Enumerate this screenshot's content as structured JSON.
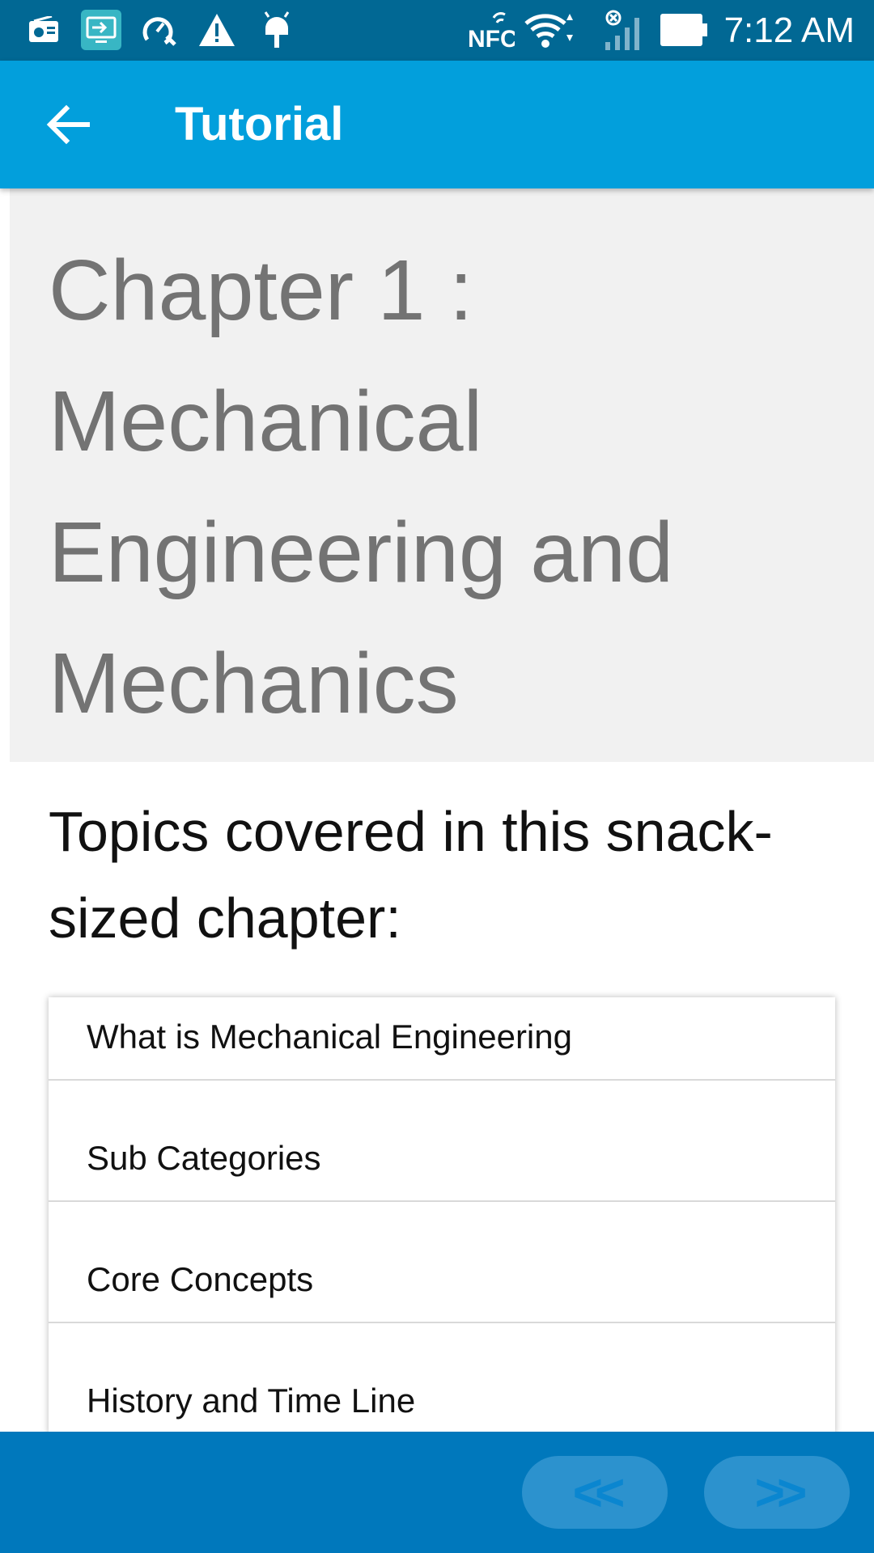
{
  "status_bar": {
    "time": "7:12 AM",
    "nfc_label": "NFC",
    "icons": [
      "radio-icon",
      "screen-share-icon",
      "speed-test-icon",
      "warning-icon",
      "android-icon",
      "nfc-icon",
      "wifi-icon",
      "signal-icon",
      "battery-icon"
    ]
  },
  "app_bar": {
    "title": "Tutorial",
    "back_icon": "arrow-left-icon"
  },
  "chapter": {
    "title": "Chapter 1 : Mechanical Engineering and Mechanics"
  },
  "topics": {
    "heading": "Topics covered in this snack-sized chapter:",
    "items": [
      {
        "label": "What is Mechanical Engineering"
      },
      {
        "label": "Sub Categories"
      },
      {
        "label": "Core Concepts"
      },
      {
        "label": "History and Time Line"
      }
    ]
  },
  "bottom_nav": {
    "prev_label": "<<",
    "next_label": ">>"
  },
  "colors": {
    "status_bar": "#016894",
    "app_bar": "#029fdc",
    "bottom_bar": "#0078bc",
    "nav_button": "#2c92ce"
  }
}
